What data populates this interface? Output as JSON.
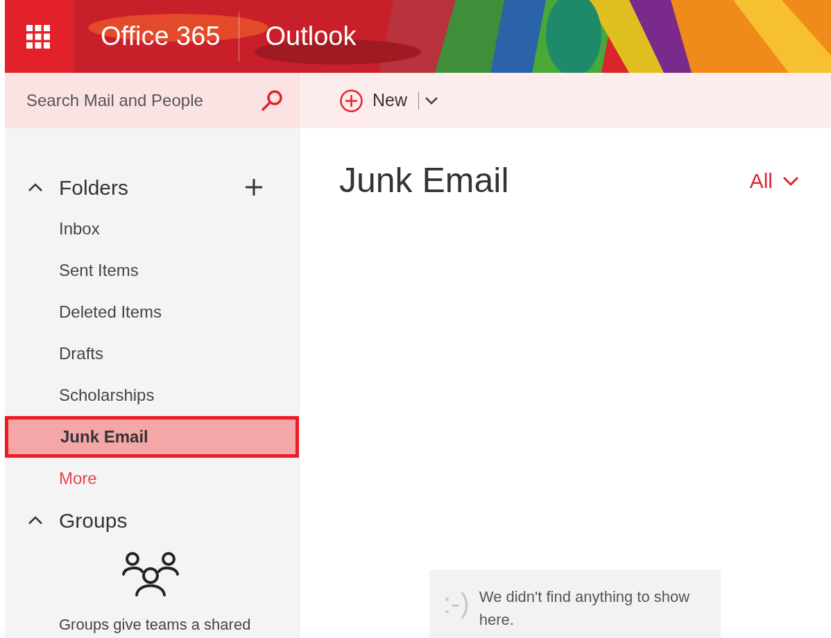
{
  "header": {
    "brand": "Office 365",
    "app": "Outlook"
  },
  "search": {
    "placeholder": "Search Mail and People"
  },
  "toolbar": {
    "new_label": "New"
  },
  "folders": {
    "title": "Folders",
    "expanded": true,
    "items": [
      {
        "label": "Inbox",
        "selected": false
      },
      {
        "label": "Sent Items",
        "selected": false
      },
      {
        "label": "Deleted Items",
        "selected": false
      },
      {
        "label": "Drafts",
        "selected": false
      },
      {
        "label": "Scholarships",
        "selected": false
      },
      {
        "label": "Junk Email",
        "selected": true
      }
    ],
    "more": "More"
  },
  "groups": {
    "title": "Groups",
    "expanded": true,
    "description": "Groups give teams a shared"
  },
  "view": {
    "title": "Junk Email",
    "filter": "All"
  },
  "empty_state": {
    "emoticon": ":-)",
    "message": "We didn't find anything to show here."
  }
}
